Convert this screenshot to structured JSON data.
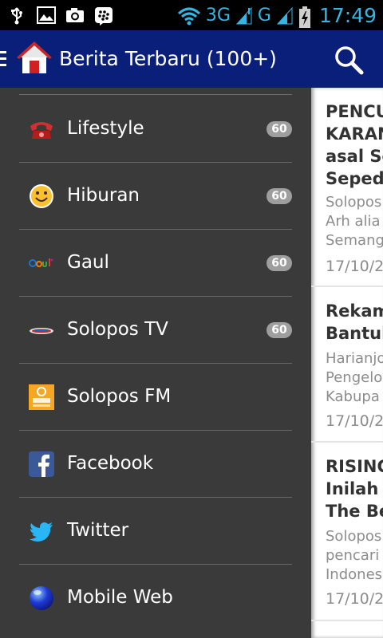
{
  "status_bar": {
    "network_3g": "3G",
    "network_g": "G",
    "time": "17:49"
  },
  "action_bar": {
    "title": "Berita Terbaru (100+)"
  },
  "drawer": {
    "items": [
      {
        "label": "Lifestyle",
        "badge": "60",
        "icon": "red-phone-icon"
      },
      {
        "label": "Hiburan",
        "badge": "60",
        "icon": "smiley-icon"
      },
      {
        "label": "Gaul",
        "badge": "60",
        "icon": "gaul-logo-icon"
      },
      {
        "label": "Solopos TV",
        "badge": "60",
        "icon": "solopos-tv-logo-icon"
      },
      {
        "label": "Solopos FM",
        "badge": "",
        "icon": "solopos-fm-logo-icon"
      },
      {
        "label": "Facebook",
        "badge": "",
        "icon": "facebook-icon"
      },
      {
        "label": "Twitter",
        "badge": "",
        "icon": "twitter-icon"
      },
      {
        "label": "Mobile Web",
        "badge": "",
        "icon": "globe-icon"
      }
    ]
  },
  "articles": [
    {
      "title": "PENCU\nKARAN\nasal Se\nSepeda",
      "snippet": "Solopos\nArh alia\nSemang",
      "date": "17/10/2"
    },
    {
      "title": "Rekam\nBantul",
      "snippet": "Harianjo\nPengelo\nKabupa",
      "date": "17/10/2"
    },
    {
      "title": "RISING\nInilah D\nThe Be",
      "snippet": "Solopos\npencari\nIndones",
      "date": "17/10/2"
    }
  ],
  "colors": {
    "action_bar": "#0a1f7a",
    "drawer_bg": "#3a3a3a",
    "status_accent": "#33b5e5",
    "badge_bg": "#9e9e9e"
  }
}
